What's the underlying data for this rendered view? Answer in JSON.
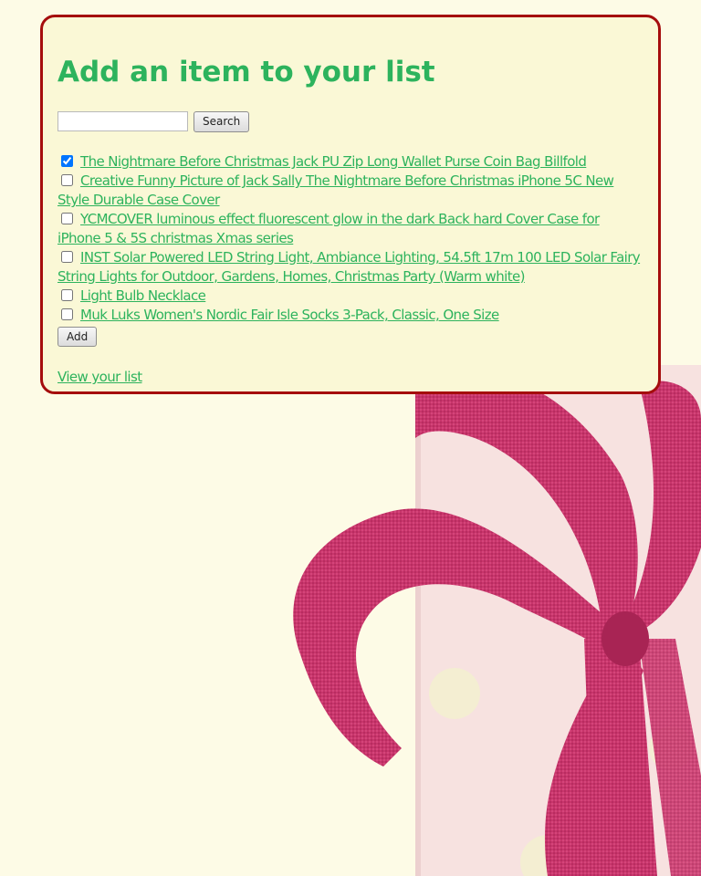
{
  "page": {
    "title": "Add an item to your list",
    "colors": {
      "accent": "#2db35d",
      "panel_background": "#faf8d6",
      "panel_border": "#a50d0d",
      "page_background": "#fdfbe6",
      "ribbon": "#c8356b"
    }
  },
  "search": {
    "value": "",
    "placeholder": "",
    "button_label": "Search"
  },
  "items": [
    {
      "label": "The Nightmare Before Christmas Jack PU Zip Long Wallet Purse Coin Bag Billfold",
      "checked": true
    },
    {
      "label": "Creative Funny Picture of Jack Sally The Nightmare Before Christmas iPhone 5C New Style Durable Case Cover",
      "checked": false
    },
    {
      "label": "YCMCOVER luminous effect fluorescent glow in the dark Back hard Cover Case for iPhone 5 & 5S christmas Xmas series",
      "checked": false
    },
    {
      "label": "INST Solar Powered LED String Light, Ambiance Lighting, 54.5ft 17m 100 LED Solar Fairy String Lights for Outdoor, Gardens, Homes, Christmas Party (Warm white)",
      "checked": false
    },
    {
      "label": "Light Bulb Necklace",
      "checked": false
    },
    {
      "label": "Muk Luks Women's Nordic Fair Isle Socks 3-Pack, Classic, One Size",
      "checked": false
    }
  ],
  "add_button_label": "Add",
  "view_list_link": "View your list",
  "background_image": "gift-box-with-pink-ribbon"
}
